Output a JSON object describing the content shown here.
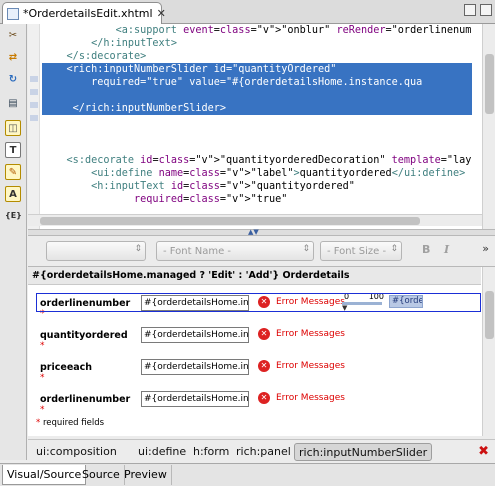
{
  "editor_tab": {
    "title": "*OrderdetailsEdit.xhtml",
    "close": "✕"
  },
  "palette": {
    "icons": [
      "tools-icon",
      "arrows-icon",
      "refresh-icon",
      "page-icon",
      "layout-icon",
      "text-icon",
      "edit-icon",
      "highlight-icon",
      "expression-icon"
    ],
    "glyphs": [
      "✂",
      "⇄",
      "↻",
      "▤",
      "◫",
      "T",
      "✎",
      "A",
      "{E}"
    ]
  },
  "source_lines": [
    {
      "text": "            <a:support event=\"onblur\" reRender=\"orderlinenumbe",
      "hl": false
    },
    {
      "text": "        </h:inputText>",
      "hl": false
    },
    {
      "text": "    </s:decorate>",
      "hl": false
    },
    {
      "text": "    <rich:inputNumberSlider id=\"quantityOrdered\"",
      "hl": true
    },
    {
      "text": "        required=\"true\" value=\"#{orderdetailsHome.instance.qua",
      "hl": true
    },
    {
      "text": "",
      "hl": true
    },
    {
      "text": "     </rich:inputNumberSlider>",
      "hl": true
    },
    {
      "text": "",
      "hl": false
    },
    {
      "text": "",
      "hl": false
    },
    {
      "text": "",
      "hl": false
    },
    {
      "text": "    <s:decorate id=\"quantityorderedDecoration\" template=\"layou",
      "hl": false
    },
    {
      "text": "        <ui:define name=\"label\">quantityordered</ui:define>",
      "hl": false
    },
    {
      "text": "        <h:inputText id=\"quantityordered\"",
      "hl": false
    },
    {
      "text": "               required=\"true\"",
      "hl": false
    }
  ],
  "toolbar": {
    "style_combo": "",
    "font_name": "- Font Name -",
    "font_size": "- Font Size -",
    "bold": "B",
    "italic": "I",
    "more": "»"
  },
  "visual": {
    "header": "#{orderdetailsHome.managed ? 'Edit' : 'Add'} Orderdetails",
    "rows": [
      {
        "label": "orderlinenumber",
        "value": "#{orderdetailsHome.instan",
        "message": "Error Messages"
      },
      {
        "label": "quantityordered",
        "value": "#{orderdetailsHome.instan",
        "message": "Error Messages"
      },
      {
        "label": "priceeach",
        "value": "#{orderdetailsHome.instan",
        "message": "Error Messages"
      },
      {
        "label": "orderlinenumber",
        "value": "#{orderdetailsHome.instan",
        "message": "Error Messages"
      }
    ],
    "required_star": "*",
    "error_icon": "✕",
    "slider": {
      "min": "0",
      "max": "100"
    },
    "binding_tag": "#{order",
    "required_note": "required fields"
  },
  "breadcrumbs": [
    "ui:composition",
    "ui:define",
    "h:form",
    "rich:panel",
    "rich:inputNumberSlider"
  ],
  "bottom_tabs": [
    "Visual/Source",
    "Source",
    "Preview"
  ],
  "colors": {
    "selection": "#3873c2",
    "error": "#d22222",
    "selected_frame": "#1b2fd6"
  }
}
